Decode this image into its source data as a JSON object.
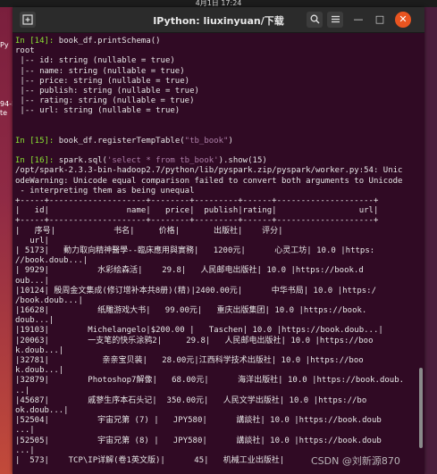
{
  "desktop": {
    "clock": "4月1日  17:24",
    "left_labels": [
      "Py",
      "94-P",
      "te"
    ]
  },
  "window": {
    "title": "IPython: liuxinyuan/下载",
    "new_tab_icon": "new-tab-icon",
    "search_icon": "search-icon",
    "menu_icon": "hamburger-menu-icon",
    "minimize_symbol": "—",
    "maximize_symbol": "□",
    "close_symbol": "✕",
    "accent_color": "#e95420",
    "background_color": "#300a24",
    "prompt_color": "#8ae234"
  },
  "terminal": {
    "in14_prompt": "In [14]: ",
    "in14_code": "book_df.printSchema()",
    "schema_lines": [
      "root",
      " |-- id: string (nullable = true)",
      " |-- name: string (nullable = true)",
      " |-- price: string (nullable = true)",
      " |-- publish: string (nullable = true)",
      " |-- rating: string (nullable = true)",
      " |-- url: string (nullable = true)"
    ],
    "in15_prompt": "In [15]: ",
    "in15_code_a": "book_df.registerTempTable(",
    "in15_code_str": "\"tb_book\"",
    "in15_code_b": ")",
    "in16_prompt": "In [16]: ",
    "in16_code_a": "spark.sql(",
    "in16_code_str": "'select * from tb_book'",
    "in16_code_b": ").show(15)",
    "output_lines": [
      "/opt/spark-2.3.3-bin-hadoop2.7/python/lib/pyspark.zip/pyspark/worker.py:54: Unic",
      "odeWarning: Unicode equal comparison failed to convert both arguments to Unicode",
      " - interpreting them as being unequal",
      "+-----+--------------------+--------+---------+------+--------------------+",
      "|   id|                name|   price|  publish|rating|                 url|",
      "+-----+--------------------+--------+---------+------+--------------------+",
      "|   序号|            书名|     价格|       出版社|    评分|",
      "   url|",
      "| 5173|   動力取向精神醫學--臨床應用與實務|   1200元|      心灵工坊| 10.0 |https:",
      "//book.doub...|",
      "| 9929|          水彩绘森活|    29.8|   人民邮电出版社| 10.0 |https://book.d",
      "oub...|",
      "|10124| 殷周金文集成(修订增补本共8册)(精)|2400.00元|      中华书局| 10.0 |https:/",
      "/book.doub...|",
      "|16628|          纸雕游戏大书|   99.00元|   重庆出版集团| 10.0 |https://book.",
      "doub...|",
      "|19103|        Michelangelo|$200.00 |   Taschen| 10.0 |https://book.doub...|",
      "|20063|        一支笔的快乐涂鸦2|     29.8|   人民邮电出版社| 10.0 |https://boo",
      "k.doub...|",
      "|32781|           亲亲宝贝装|   28.00元|江西科学技术出版社| 10.0 |https://boo",
      "k.doub...|",
      "|32879|        Photoshop7解像|   68.00元|      海洋出版社| 10.0 |https://book.doub.",
      "..|",
      "|45687|        戚蓼生序本石头记|  350.00元|   人民文学出版社| 10.0 |https://bo",
      "ok.doub...|",
      "|52504|          宇宙兄第 (7) |   JPY580|      講談社| 10.0 |https://book.doub",
      "...|",
      "|52505|          宇宙兄第 (8) |   JPY580|      講談社| 10.0 |https://book.doub",
      "...|",
      "|  573|    TCP\\IP详解(卷1英文版)|      45|   机械工业出版社|"
    ],
    "watermark": "CSDN @刘新源870"
  }
}
